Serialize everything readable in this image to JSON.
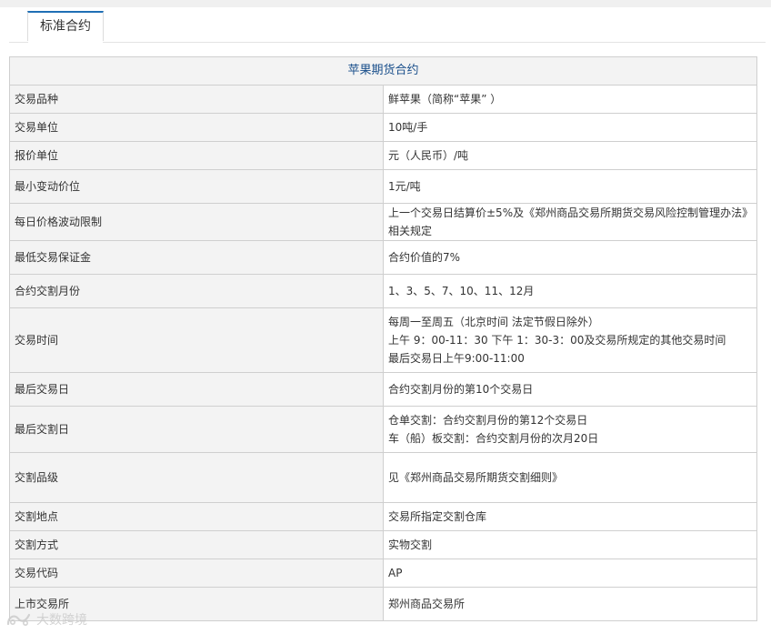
{
  "tabs": [
    {
      "label": "标准合约",
      "active": true
    }
  ],
  "table": {
    "title": "苹果期货合约",
    "rows": [
      {
        "label": "交易品种",
        "lines": [
          " 鲜苹果（简称“苹果” ）"
        ]
      },
      {
        "label": "交易单位",
        "lines": [
          "10吨/手"
        ]
      },
      {
        "label": "报价单位",
        "lines": [
          "元（人民币）/吨"
        ]
      },
      {
        "label": "最小变动价位",
        "lines": [
          "1元/吨"
        ]
      },
      {
        "label": "每日价格波动限制",
        "lines": [
          "上一个交易日结算价±5%及《郑州商品交易所期货交易风险控制管理办法》相关规定"
        ]
      },
      {
        "label": "最低交易保证金",
        "lines": [
          "合约价值的7%"
        ]
      },
      {
        "label": "合约交割月份",
        "lines": [
          "1、3、5、7、10、11、12月"
        ]
      },
      {
        "label": "交易时间",
        "lines": [
          "每周一至周五（北京时间 法定节假日除外）",
          "上午 9：00-11：30 下午 1：30-3：00及交易所规定的其他交易时间",
          "最后交易日上午9:00-11:00"
        ]
      },
      {
        "label": "最后交易日",
        "lines": [
          "合约交割月份的第10个交易日"
        ]
      },
      {
        "label": "最后交割日",
        "lines": [
          "仓单交割：合约交割月份的第12个交易日",
          "车（船）板交割：合约交割月份的次月20日"
        ]
      },
      {
        "label": "交割品级",
        "lines": [
          "见《郑州商品交易所期货交割细则》"
        ]
      },
      {
        "label": "交割地点",
        "lines": [
          "交易所指定交割仓库"
        ]
      },
      {
        "label": "交割方式",
        "lines": [
          "实物交割"
        ]
      },
      {
        "label": "交易代码",
        "lines": [
          "AP"
        ]
      },
      {
        "label": "上市交易所",
        "lines": [
          "郑州商品交易所"
        ]
      }
    ]
  },
  "watermark": {
    "text": "大数跨境"
  },
  "colors": {
    "tab_accent": "#1f6fb5",
    "title_text": "#1a4f8b",
    "label_bg": "#f3f3f3",
    "border": "#cfcfcf"
  }
}
